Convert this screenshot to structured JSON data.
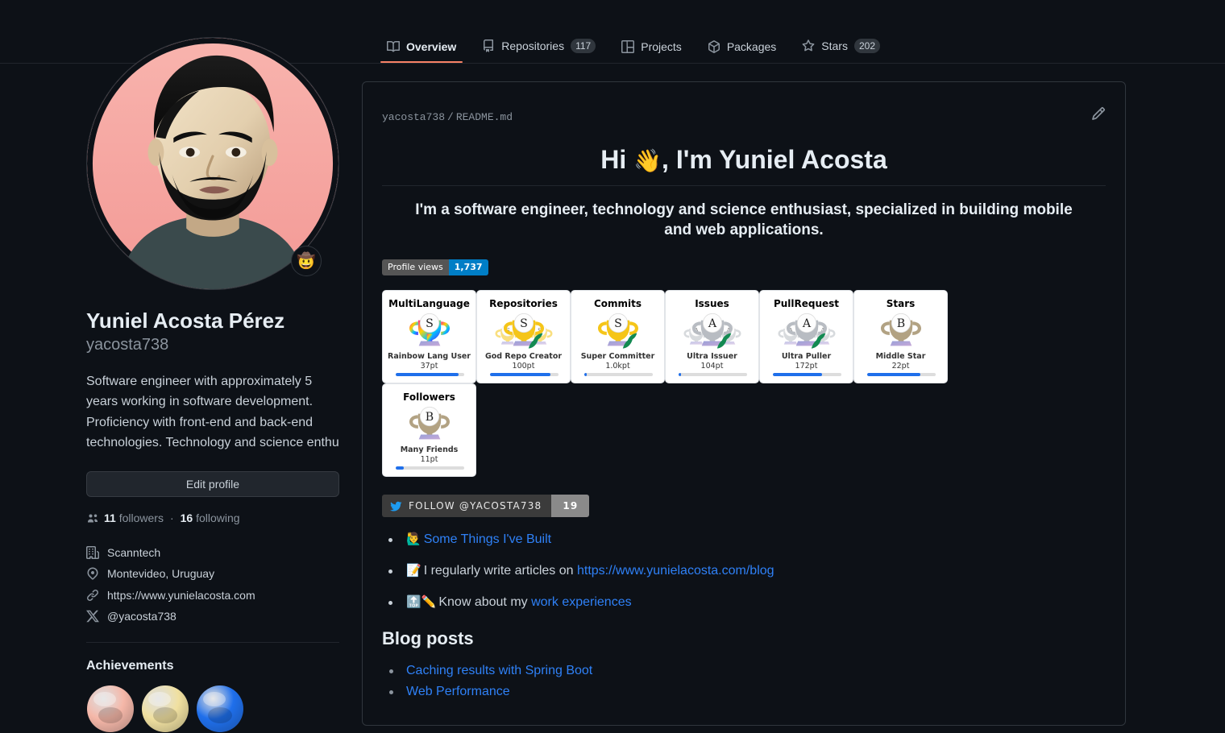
{
  "nav": {
    "items": [
      {
        "label": "Overview",
        "icon": "book-icon",
        "count": null,
        "active": true
      },
      {
        "label": "Repositories",
        "icon": "repo-icon",
        "count": "117",
        "active": false
      },
      {
        "label": "Projects",
        "icon": "project-icon",
        "count": null,
        "active": false
      },
      {
        "label": "Packages",
        "icon": "package-icon",
        "count": null,
        "active": false
      },
      {
        "label": "Stars",
        "icon": "star-icon",
        "count": "202",
        "active": false
      }
    ]
  },
  "sidebar": {
    "avatar_alt": "Yuniel Acosta Pérez avatar",
    "status_emoji": "🤠",
    "full_name": "Yuniel Acosta Pérez",
    "login": "yacosta738",
    "bio": "Software engineer with approximately 5 years working in software development. Proficiency with front-end and back-end technologies. Technology and science enthu",
    "edit_profile_label": "Edit profile",
    "followers_count": "11",
    "followers_label": "followers",
    "following_count": "16",
    "following_label": "following",
    "meta": [
      {
        "icon": "organization-icon",
        "text": "Scanntech"
      },
      {
        "icon": "location-icon",
        "text": "Montevideo, Uruguay"
      },
      {
        "icon": "link-icon",
        "text": "https://www.yunielacosta.com"
      },
      {
        "icon": "twitter-icon",
        "text": "@yacosta738"
      }
    ],
    "achievements_title": "Achievements",
    "achievements": [
      {
        "name": "pair-extraordinaire-badge",
        "color": "#f5b7a8"
      },
      {
        "name": "pull-shark-badge",
        "color": "#f0e0a0"
      },
      {
        "name": "arctic-code-vault-badge",
        "color": "#1f6feb"
      }
    ]
  },
  "readme": {
    "owner": "yacosta738",
    "separator": "/",
    "filename": "README.md",
    "edit_icon": "pencil-icon",
    "heading": "Hi 👋, I'm Yuniel Acosta",
    "heading_prefix": "Hi ",
    "heading_emoji": "👋",
    "heading_suffix": ", I'm Yuniel Acosta",
    "lead": "I'm a software engineer, technology and science enthusiast, specialized in building mobile and web applications.",
    "profile_views": {
      "label": "Profile views",
      "value": "1,737"
    },
    "twitter_follow": {
      "label": "FOLLOW @YACOSTA738",
      "count": "19",
      "icon": "twitter-icon"
    },
    "links": [
      {
        "emoji": "🙋‍♂️",
        "prefix": "",
        "link_text": "Some Things I've Built",
        "suffix": ""
      },
      {
        "emoji": "📝",
        "prefix": "I regularly write articles on ",
        "link_text": "https://www.yunielacosta.com/blog",
        "suffix": ""
      },
      {
        "emoji": "🔝✏️",
        "prefix": "Know about my ",
        "link_text": "work experiences",
        "suffix": ""
      }
    ],
    "blog_title": "Blog posts",
    "blog_posts": [
      {
        "title": "Caching results with Spring Boot"
      },
      {
        "title": "Web Performance"
      }
    ]
  },
  "trophies": [
    {
      "title": "MultiLanguage",
      "rank": "S",
      "name": "Rainbow Lang User",
      "points": "37pt",
      "progress": 92,
      "style": "rainbow",
      "cups": 1,
      "laurel": false
    },
    {
      "title": "Repositories",
      "rank": "S",
      "name": "God Repo Creator",
      "points": "100pt",
      "progress": 88,
      "style": "gold",
      "cups": 3,
      "laurel": true
    },
    {
      "title": "Commits",
      "rank": "S",
      "name": "Super Committer",
      "points": "1.0kpt",
      "progress": 4,
      "style": "gold",
      "cups": 1,
      "laurel": true
    },
    {
      "title": "Issues",
      "rank": "A",
      "name": "Ultra Issuer",
      "points": "104pt",
      "progress": 4,
      "style": "silver",
      "cups": 3,
      "laurel": true
    },
    {
      "title": "PullRequest",
      "rank": "A",
      "name": "Ultra Puller",
      "points": "172pt",
      "progress": 72,
      "style": "silver",
      "cups": 3,
      "laurel": true
    },
    {
      "title": "Stars",
      "rank": "B",
      "name": "Middle Star",
      "points": "22pt",
      "progress": 78,
      "style": "bronze",
      "cups": 1,
      "laurel": false
    },
    {
      "title": "Followers",
      "rank": "B",
      "name": "Many Friends",
      "points": "11pt",
      "progress": 12,
      "style": "bronze",
      "cups": 1,
      "laurel": false
    }
  ],
  "colors": {
    "background": "#0d1117",
    "border": "#30363d",
    "accent_link": "#2f81f7",
    "active_tab_underline": "#f78166",
    "badge_blue": "#007ec6",
    "progress_blue": "#1f6feb"
  }
}
